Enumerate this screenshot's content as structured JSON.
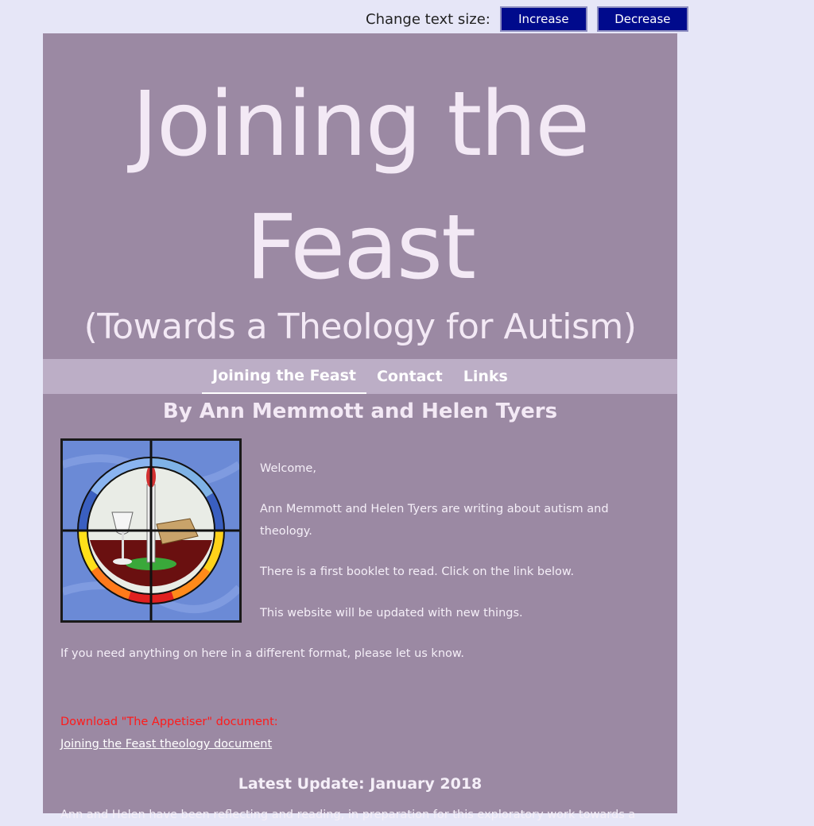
{
  "text_size": {
    "label": "Change text size:",
    "increase": "Increase",
    "decrease": "Decrease"
  },
  "hero": {
    "title_line1": "Joining the",
    "title_line2": "Feast",
    "subtitle": "(Towards a Theology for Autism)"
  },
  "nav": {
    "items": [
      "Joining the Feast",
      "Contact",
      "Links"
    ],
    "active": "Joining the Feast"
  },
  "authors": "By Ann Memmott and Helen Tyers",
  "intro": {
    "p1": "Welcome,",
    "p2": "Ann Memmott and Helen Tyers are writing about autism and theology.",
    "p3": "There is a first booklet to read. Click on the link below.",
    "p4": "This website will be updated with new things.",
    "p5": "If you need anything on here in a different format, please let us know."
  },
  "download": {
    "label": "Download \"The Appetiser\" document:",
    "link": "Joining the Feast theology document"
  },
  "update": {
    "heading": "Latest Update: January 2018",
    "text": "Ann and Helen have been reflecting and reading, in preparation for this exploratory work towards a"
  },
  "colors": {
    "page_background": "#e6e6f7",
    "content_background": "#9b89a3",
    "nav_background": "#bcaec6",
    "button_background": "#000a8c",
    "download_label": "#ff1a1a"
  },
  "image": {
    "icon": "stained-glass-window-icon"
  }
}
